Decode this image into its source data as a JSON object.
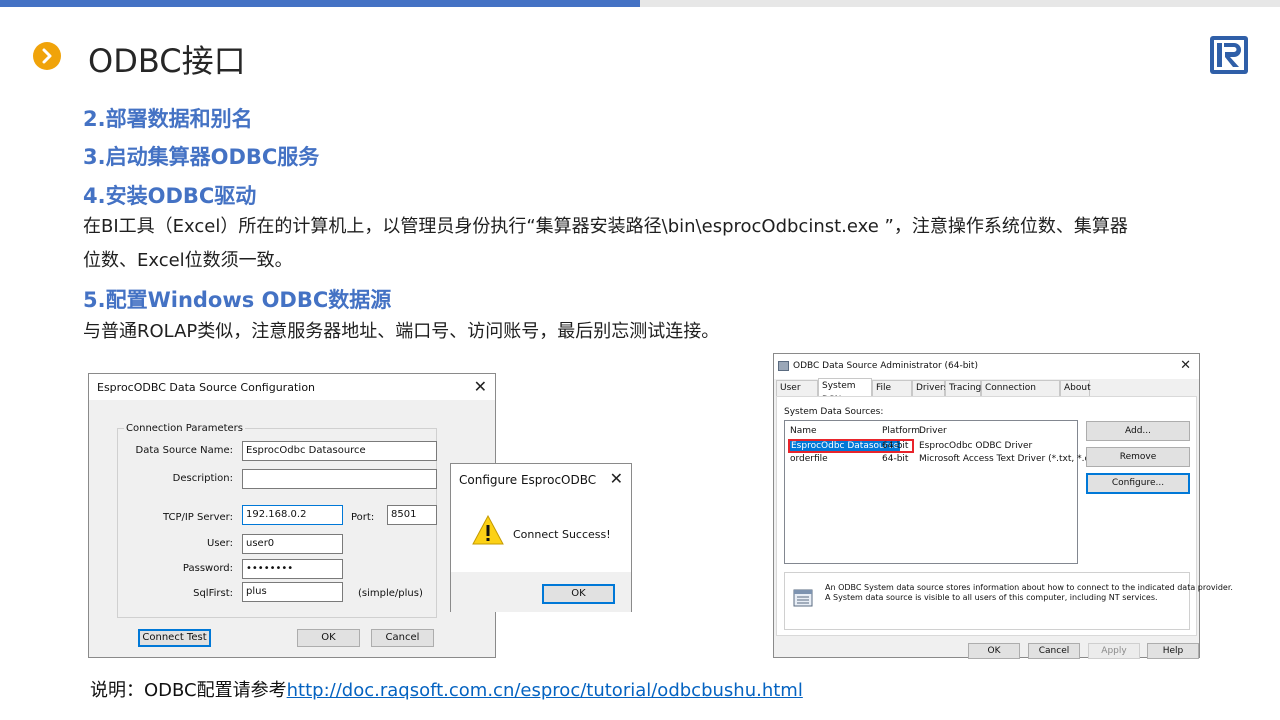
{
  "page": {
    "title": "ODBC接口",
    "sections": [
      {
        "heading": "2.部署数据和别名"
      },
      {
        "heading": "3.启动集算器ODBC服务"
      },
      {
        "heading": "4.安装ODBC驱动"
      },
      {
        "heading": "5.配置Windows ODBC数据源"
      }
    ],
    "para1_line1": "在BI工具（Excel）所在的计算机上，以管理员身份执行“集算器安装路径\\bin\\esprocOdbcinst.exe ”，注意操作系统位数、集算器",
    "para1_line2": "位数、Excel位数须一致。",
    "para2": "与普通ROLAP类似，注意服务器地址、端口号、访问账号，最后别忘测试连接。",
    "footnote_prefix": "说明：ODBC配置请参考",
    "footnote_link": "http://doc.raqsoft.com.cn/esproc/tutorial/odbcbushu.html"
  },
  "config_dialog": {
    "title": "EsprocODBC Data Source Configuration",
    "close": "✕",
    "group_label": "Connection Parameters",
    "labels": {
      "dsn": "Data Source Name:",
      "description": "Description:",
      "server": "TCP/IP Server:",
      "port": "Port:",
      "user": "User:",
      "password": "Password:",
      "sqlfirst": "SqlFirst:",
      "sqlfirst_hint": "(simple/plus)"
    },
    "values": {
      "dsn": "EsprocOdbc Datasource",
      "description": "",
      "server": "192.168.0.2",
      "port": "8501",
      "user": "user0",
      "password": "••••••••",
      "sqlfirst": "plus"
    },
    "buttons": {
      "test": "Connect Test",
      "ok": "OK",
      "cancel": "Cancel"
    }
  },
  "success_dialog": {
    "title": "Configure EsprocODBC",
    "close": "✕",
    "message": "Connect Success!",
    "ok": "OK",
    "icon": "warning-icon"
  },
  "admin_dialog": {
    "title": "ODBC Data Source Administrator (64-bit)",
    "close": "✕",
    "tabs": [
      "User DSN",
      "System DSN",
      "File DSN",
      "Drivers",
      "Tracing",
      "Connection Pooling",
      "About"
    ],
    "active_tab": "System DSN",
    "list_label": "System Data Sources:",
    "columns": [
      "Name",
      "Platform",
      "Driver"
    ],
    "rows": [
      {
        "name": "EsprocOdbc Datasource",
        "platform": "64-bit",
        "driver": "EsprocOdbc ODBC Driver"
      },
      {
        "name": "orderfile",
        "platform": "64-bit",
        "driver": "Microsoft Access Text Driver (*.txt, *.csv)"
      }
    ],
    "side_buttons": [
      "Add...",
      "Remove",
      "Configure..."
    ],
    "info_line1": "An ODBC System data source stores information about how to connect to the indicated data provider.",
    "info_line2": "A System data source is visible to all users of this computer, including NT services.",
    "bottom_buttons": [
      "OK",
      "Cancel",
      "Apply",
      "Help"
    ],
    "highlight_color": "#e8242b"
  },
  "colors": {
    "accent": "#4472c4",
    "bullet": "#f0a30a",
    "link": "#0563c1"
  }
}
